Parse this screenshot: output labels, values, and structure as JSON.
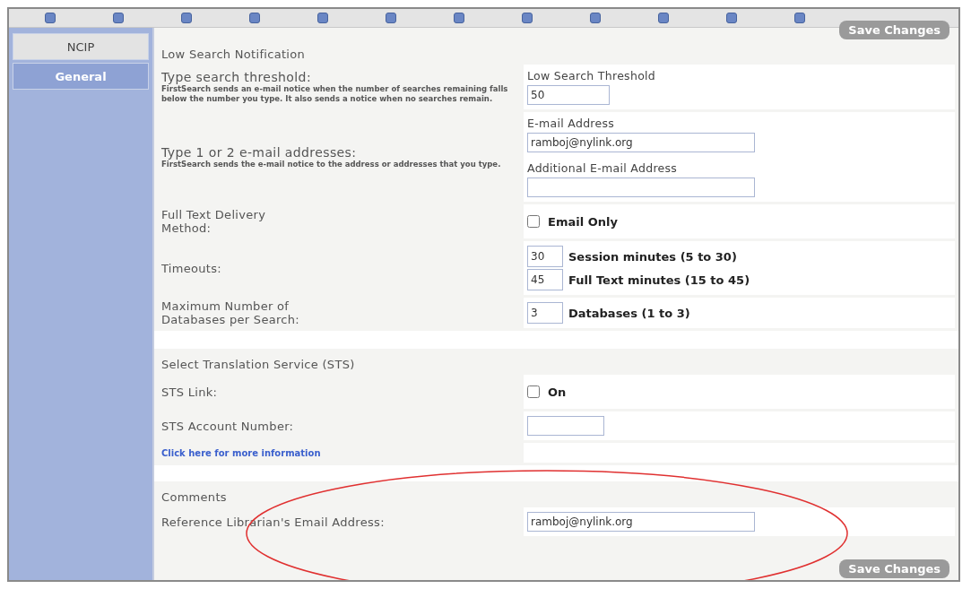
{
  "sidebar": {
    "items": [
      {
        "label": "NCIP",
        "selected": false
      },
      {
        "label": "General",
        "selected": true
      }
    ]
  },
  "top_button": {
    "label": "Save Changes"
  },
  "sections": [
    {
      "title": "Low Search Notification",
      "rows": [
        {
          "kind": "fields",
          "label": "Type search threshold:",
          "description": "FirstSearch sends an e-mail notice when the number of searches remaining falls below the number you type. It also sends a notice when no searches remain.",
          "fields": [
            {
              "label": "Low Search Threshold",
              "value": "50",
              "wide": false
            }
          ]
        },
        {
          "kind": "fields",
          "label": "Type 1 or 2 e-mail addresses:",
          "description": "FirstSearch sends the e-mail notice to the address or addresses that you type.",
          "fields": [
            {
              "label": "E-mail Address",
              "value": "ramboj@nylink.org",
              "wide": true
            },
            {
              "label": "Additional E-mail Address",
              "wide": true
            }
          ]
        },
        {
          "kind": "checkbox",
          "label": "Full Text Delivery Method:",
          "option": "Email Only",
          "checked": false
        },
        {
          "kind": "numbers",
          "label": "Timeouts:",
          "items": [
            {
              "value": "30",
              "unit": "Session minutes (5 to 30)"
            },
            {
              "value": "45",
              "unit": "Full Text minutes (15 to 45)"
            }
          ]
        },
        {
          "kind": "numbers",
          "label": "Maximum Number of Databases per Search:",
          "items": [
            {
              "value": "3",
              "unit": "Databases (1 to 3)"
            }
          ]
        }
      ]
    },
    {
      "title": "Select Translation Service (STS)",
      "rows": [
        {
          "kind": "checkbox",
          "label": "STS Link:",
          "option": "On",
          "checked": false
        },
        {
          "kind": "text_field",
          "label": "STS Account Number:",
          "wide": false
        },
        {
          "kind": "link",
          "label": "Click here for more information"
        }
      ]
    },
    {
      "title": "Comments",
      "rows": [
        {
          "kind": "text_field",
          "label": "Reference Librarian's Email Address:",
          "value": "ramboj@nylink.org",
          "wide": true
        }
      ]
    }
  ],
  "bottom_button": {
    "label": "Save Changes"
  }
}
